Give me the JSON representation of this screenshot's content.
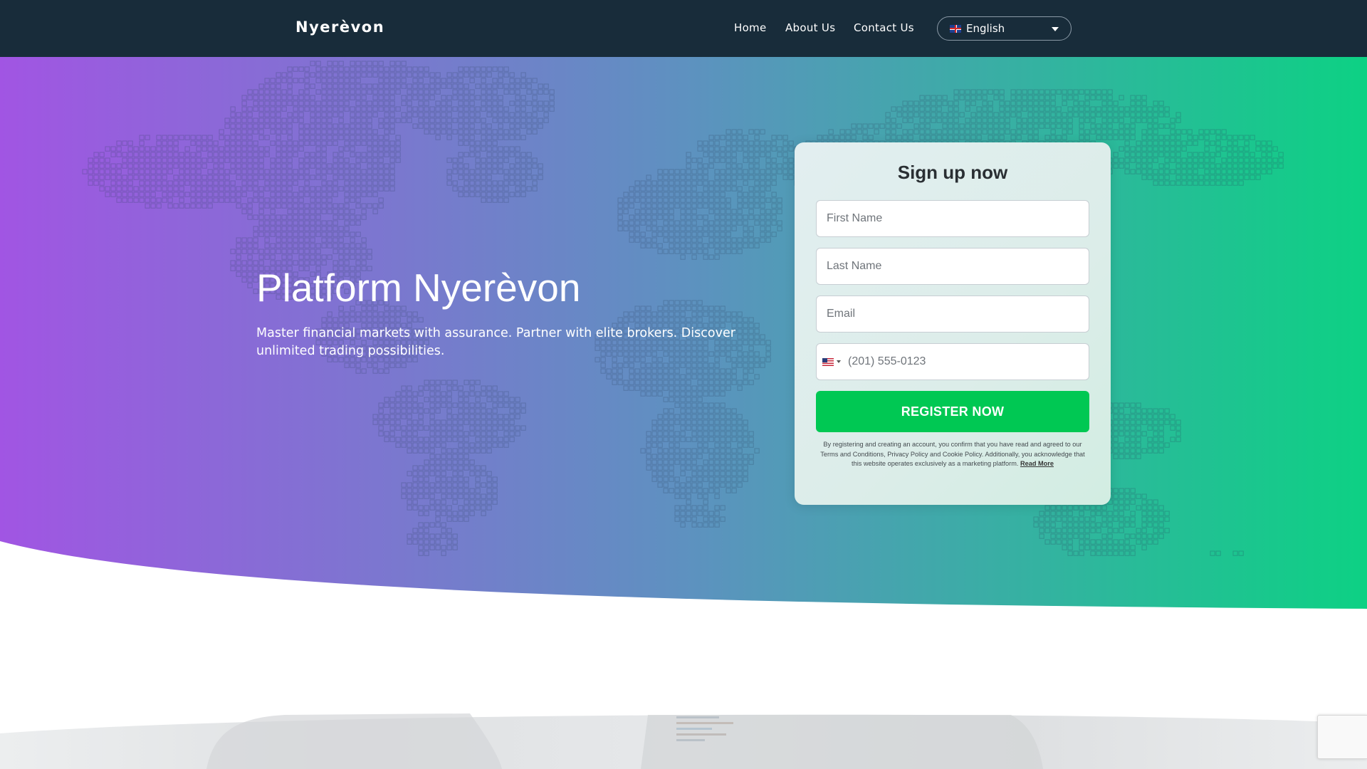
{
  "header": {
    "brand": "Nyerèvon",
    "nav": [
      "Home",
      "About Us",
      "Contact Us"
    ],
    "language": {
      "selected": "English",
      "flag_icon": "uk-flag-icon"
    }
  },
  "hero": {
    "title": "Platform Nyerèvon",
    "subtitle": "Master financial markets with assurance. Partner with elite brokers. Discover unlimited trading possibilities.",
    "gradient": {
      "start": "#a155e3",
      "mid": "#5e91c0",
      "end": "#0dd184"
    }
  },
  "signup": {
    "title": "Sign up now",
    "first_name_placeholder": "First Name",
    "last_name_placeholder": "Last Name",
    "email_placeholder": "Email",
    "phone_placeholder": "(201) 555-0123",
    "phone_flag_icon": "us-flag-icon",
    "button_label": "REGISTER NOW",
    "button_color": "#00c853",
    "disclaimer": "By registering and creating an account, you confirm that you have read and agreed to our Terms and Conditions, Privacy Policy and Cookie Policy. Additionally, you acknowledge that this website operates exclusively as a marketing platform.",
    "read_more": "Read More"
  },
  "colors": {
    "navbar": "#182c3a"
  }
}
